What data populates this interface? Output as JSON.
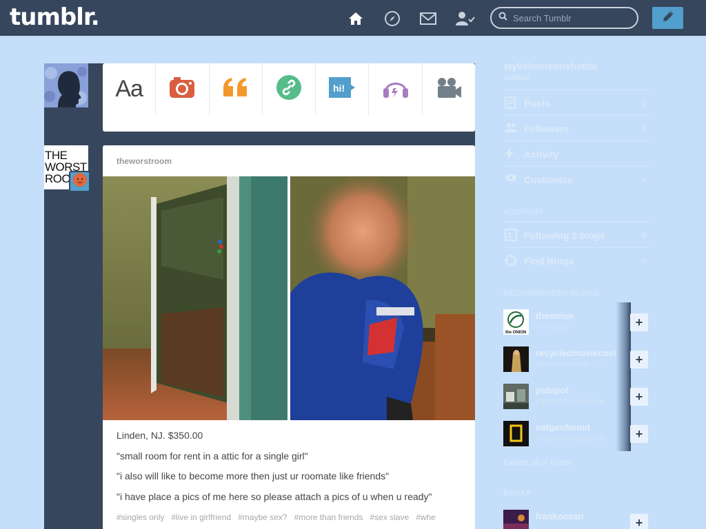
{
  "header": {
    "logo": "tumblr.",
    "search_placeholder": "Search Tumblr",
    "nav_icons": [
      "home-icon",
      "compass-icon",
      "mail-icon",
      "account-icon"
    ],
    "compose_icon": "pencil-icon"
  },
  "post_types": [
    "text-post-icon",
    "photo-post-icon",
    "quote-post-icon",
    "link-post-icon",
    "chat-post-icon",
    "audio-post-icon",
    "video-post-icon"
  ],
  "post": {
    "author": "theworstroom",
    "avatar_text": "THE WORST ROO",
    "lines": [
      "Linden, NJ. $350.00",
      "\"small room for rent in a attic for a single girl\"",
      "\"i also will like to become more then just ur roomate like friends\"",
      "\"i have place a pics of me here so please attach a pics of u when u ready\""
    ],
    "tags": [
      "#singles only",
      "#live in girlfriend",
      "#maybe sex?",
      "#more than friends",
      "#sex slave",
      "#whe"
    ]
  },
  "sidebar": {
    "blog_name": "stylishscreenshotter",
    "blog_sub": "Untitled",
    "menu": [
      {
        "label": "Posts",
        "count": "0",
        "icon": "posts-icon"
      },
      {
        "label": "Followers",
        "count": "0",
        "icon": "followers-icon"
      },
      {
        "label": "Activity",
        "count": "",
        "icon": "activity-icon"
      },
      {
        "label": "Customize",
        "count": ">",
        "icon": "customize-icon"
      }
    ],
    "account_heading": "ACCOUNT",
    "account_menu": [
      {
        "label": "Following 2 blogs",
        "count": "0",
        "icon": "following-icon"
      },
      {
        "label": "Find Blogs",
        "count": ">",
        "icon": "find-blogs-icon"
      }
    ],
    "recommended_heading": "RECOMMENDED BLOGS",
    "recommended": [
      {
        "name": "theonion",
        "desc": "The Onion"
      },
      {
        "name": "recycledmoviecostumes",
        "desc": "Recycled Movie Co..."
      },
      {
        "name": "pobipof",
        "desc": "Fanfare in Magazine"
      },
      {
        "name": "natgeofound",
        "desc": "National Geographic"
      }
    ],
    "explore": "Explore all of Tumblr",
    "radar_heading": "RADAR",
    "radar_blog": "frankocean"
  },
  "colors": {
    "header_bg": "#36465d",
    "page_bg": "#c5dffb",
    "accent": "#529ecc"
  }
}
